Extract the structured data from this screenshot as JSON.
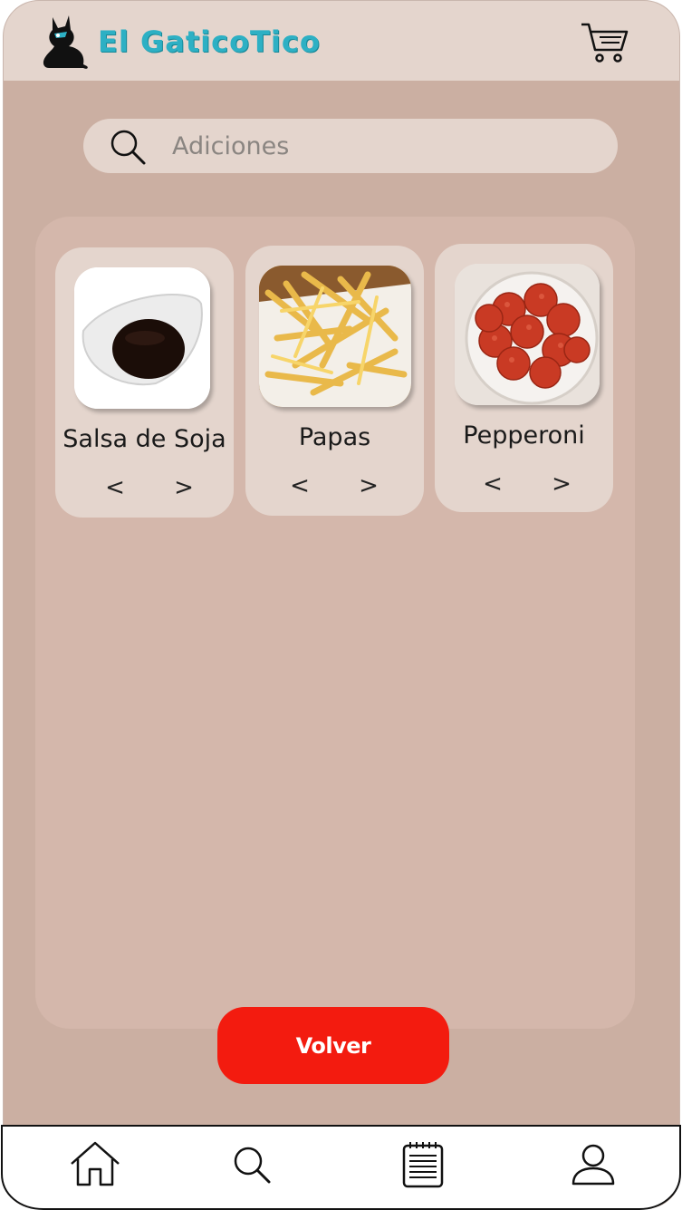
{
  "app": {
    "brand": "El GaticoTico"
  },
  "search": {
    "placeholder": "Adiciones"
  },
  "products": [
    {
      "name": "Salsa de Soja",
      "prev": "<",
      "next": ">"
    },
    {
      "name": "Papas",
      "prev": "<",
      "next": ">"
    },
    {
      "name": "Pepperoni",
      "prev": "<",
      "next": ">"
    }
  ],
  "actions": {
    "back_label": "Volver"
  },
  "icons": {
    "cart": "cart-icon",
    "search": "search-icon",
    "home": "home-icon",
    "orders": "notepad-icon",
    "profile": "user-icon"
  },
  "colors": {
    "header": "#e4d5cd",
    "background": "#cbafa2",
    "panel": "#d4b7ab",
    "card": "#e4d5cd",
    "brand": "#2db0c4",
    "button": "#f31b0f"
  }
}
